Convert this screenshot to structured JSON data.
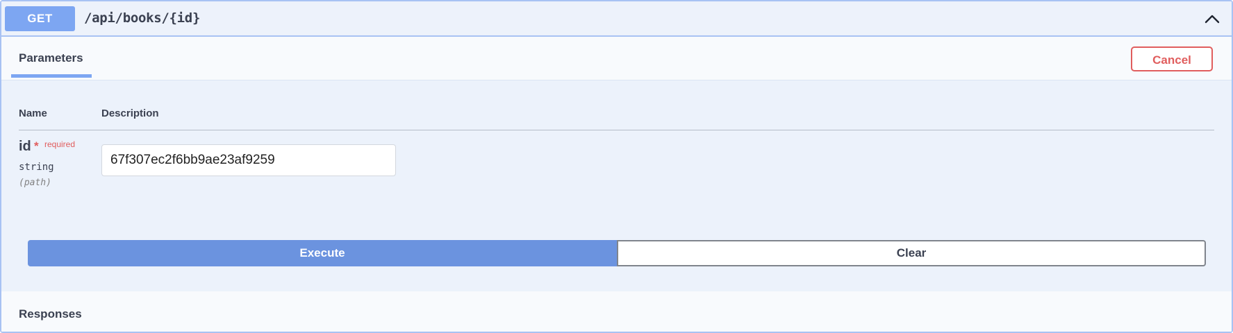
{
  "operation": {
    "method": "GET",
    "path": "/api/books/{id}",
    "method_color": "#7da6f2",
    "border_color": "#a8c2f3",
    "collapse_icon": "chevron-up-icon"
  },
  "tabs": {
    "active_label": "Parameters",
    "cancel_label": "Cancel"
  },
  "parameters": {
    "columns": [
      "Name",
      "Description"
    ],
    "items": [
      {
        "name": "id",
        "required_marker": "*",
        "required_label": "required",
        "type": "string",
        "in": "(path)",
        "value": "67f307ec2f6bb9ae23af9259"
      }
    ]
  },
  "actions": {
    "execute_label": "Execute",
    "clear_label": "Clear",
    "execute_color": "#6b93df",
    "cancel_color": "#e05d5d"
  },
  "responses": {
    "title": "Responses"
  }
}
